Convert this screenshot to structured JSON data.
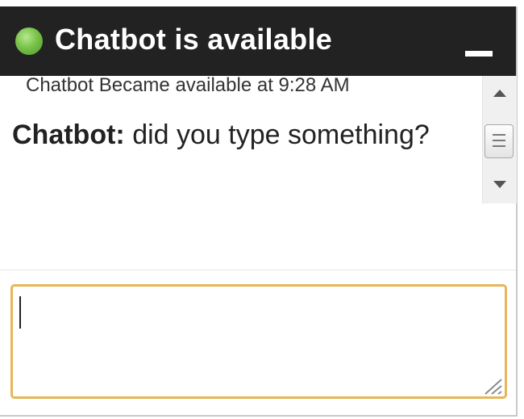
{
  "header": {
    "title": "Chatbot is available",
    "status_color": "#79c24a",
    "status_icon": "status-dot-icon",
    "minimize_icon": "minimize-icon"
  },
  "messages": {
    "system_notice": "Chatbot Became available at 9:28 AM",
    "items": [
      {
        "sender": "Chatbot:",
        "text": " did you type something?"
      }
    ]
  },
  "input": {
    "value": "",
    "border_color": "#e8b55a"
  },
  "scrollbar": {
    "up_icon": "arrow-up-icon",
    "down_icon": "arrow-down-icon"
  }
}
